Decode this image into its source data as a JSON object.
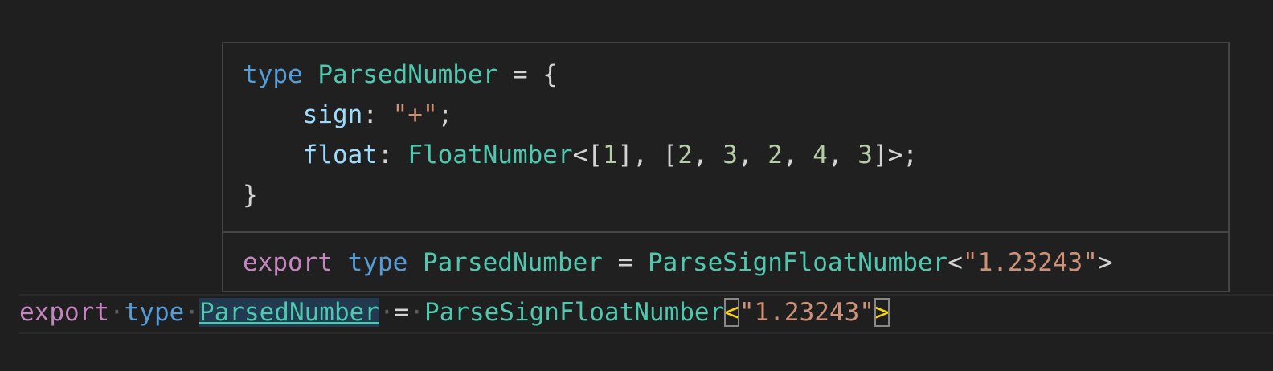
{
  "hover": {
    "lines": [
      {
        "kw": "type",
        "name": "ParsedNumber",
        "eq": " = {"
      },
      {
        "prop": "sign",
        "colon": ": ",
        "str": "\"+\"",
        "semi": ";"
      },
      {
        "prop": "float",
        "colon": ": ",
        "type": "FloatNumber",
        "open": "<[",
        "n1": "1",
        "mid": "], [",
        "nums": [
          "2",
          "3",
          "2",
          "4",
          "3"
        ],
        "sep": ", ",
        "close": "]>;"
      },
      {
        "brace": "}"
      }
    ],
    "signature": {
      "export": "export",
      "type_kw": "type",
      "name": "ParsedNumber",
      "eq": " = ",
      "generic": "ParseSignFloatNumber",
      "lt": "<",
      "arg": "\"1.23243\"",
      "gt": ">"
    }
  },
  "editor": {
    "line": {
      "export": "export",
      "type_kw": "type",
      "name": "ParsedNumber",
      "eq": "=",
      "generic": "ParseSignFloatNumber",
      "lt": "<",
      "arg": "\"1.23243\"",
      "gt": ">",
      "ws": "·"
    }
  },
  "colors": {
    "background": "#1f1f1f",
    "keyword_export": "#c586c0",
    "keyword_type": "#569cd6",
    "type_name": "#4ec9b0",
    "property": "#9cdcfe",
    "string": "#ce9178",
    "number": "#b5cea8",
    "bracket_match": "#ffd700"
  }
}
